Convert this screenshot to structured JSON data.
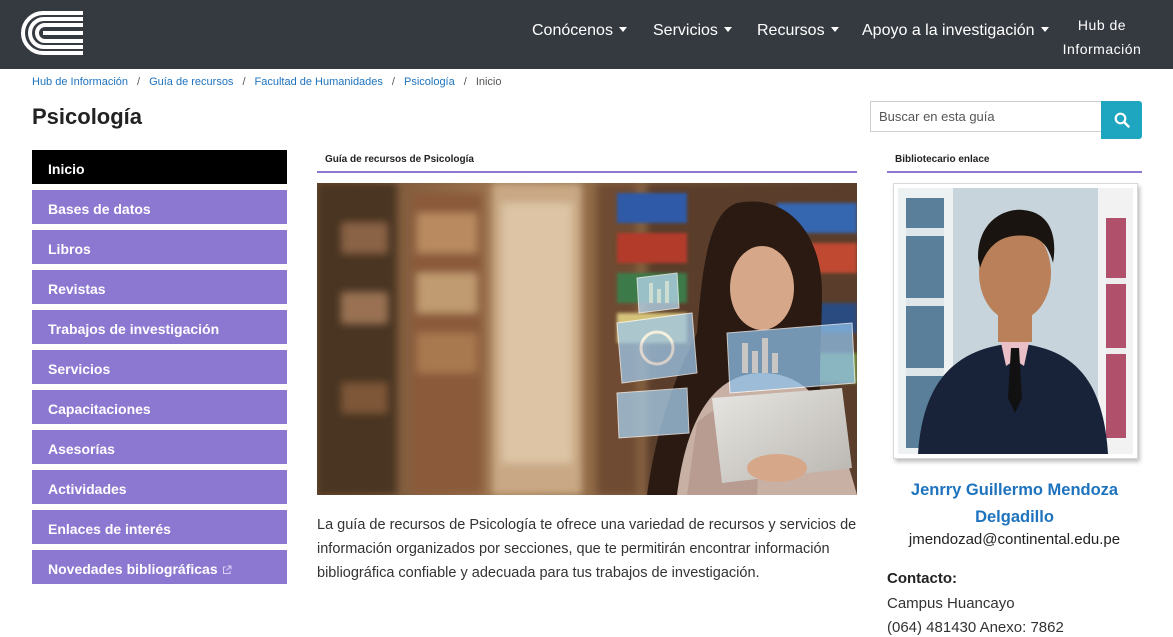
{
  "header": {
    "nav": [
      {
        "label": "Conócenos"
      },
      {
        "label": "Servicios"
      },
      {
        "label": "Recursos"
      },
      {
        "label": "Apoyo a la investigación"
      }
    ],
    "hub_line1": "Hub de",
    "hub_line2": "Información"
  },
  "breadcrumb": [
    {
      "label": "Hub de Información"
    },
    {
      "label": "Guía de recursos"
    },
    {
      "label": "Facultad de Humanidades"
    },
    {
      "label": "Psicología"
    },
    {
      "label": "Inicio"
    }
  ],
  "page_title": "Psicología",
  "search": {
    "placeholder": "Buscar en esta guía"
  },
  "sidebar": {
    "items": [
      {
        "label": "Inicio",
        "active": true
      },
      {
        "label": "Bases de datos"
      },
      {
        "label": "Libros"
      },
      {
        "label": "Revistas"
      },
      {
        "label": "Trabajos de investigación"
      },
      {
        "label": "Servicios"
      },
      {
        "label": "Capacitaciones"
      },
      {
        "label": "Asesorías"
      },
      {
        "label": "Actividades"
      },
      {
        "label": "Enlaces de interés"
      },
      {
        "label": "Novedades bibliográficas",
        "external": true
      }
    ]
  },
  "main": {
    "box_title": "Guía de recursos de Psicología",
    "intro": "La guía de recursos de Psicología te ofrece una variedad de recursos y servicios de información organizados por secciones, que te permitirán encontrar información bibliográfica confiable y adecuada para tus trabajos de investigación."
  },
  "right": {
    "box_title": "Bibliotecario enlace",
    "name_line1": "Jenrry Guillermo Mendoza",
    "name_line2": "Delgadillo",
    "email": "jmendozad@continental.edu.pe",
    "contact_label": "Contacto:",
    "campus": "Campus Huancayo",
    "phone": "(064) 481430 Anexo: 7862"
  },
  "colors": {
    "header_bg": "#353a41",
    "sidebar_item": "#8c77d1",
    "sidebar_active": "#000000",
    "link": "#1e73be",
    "search_button": "#1ea6c0"
  }
}
